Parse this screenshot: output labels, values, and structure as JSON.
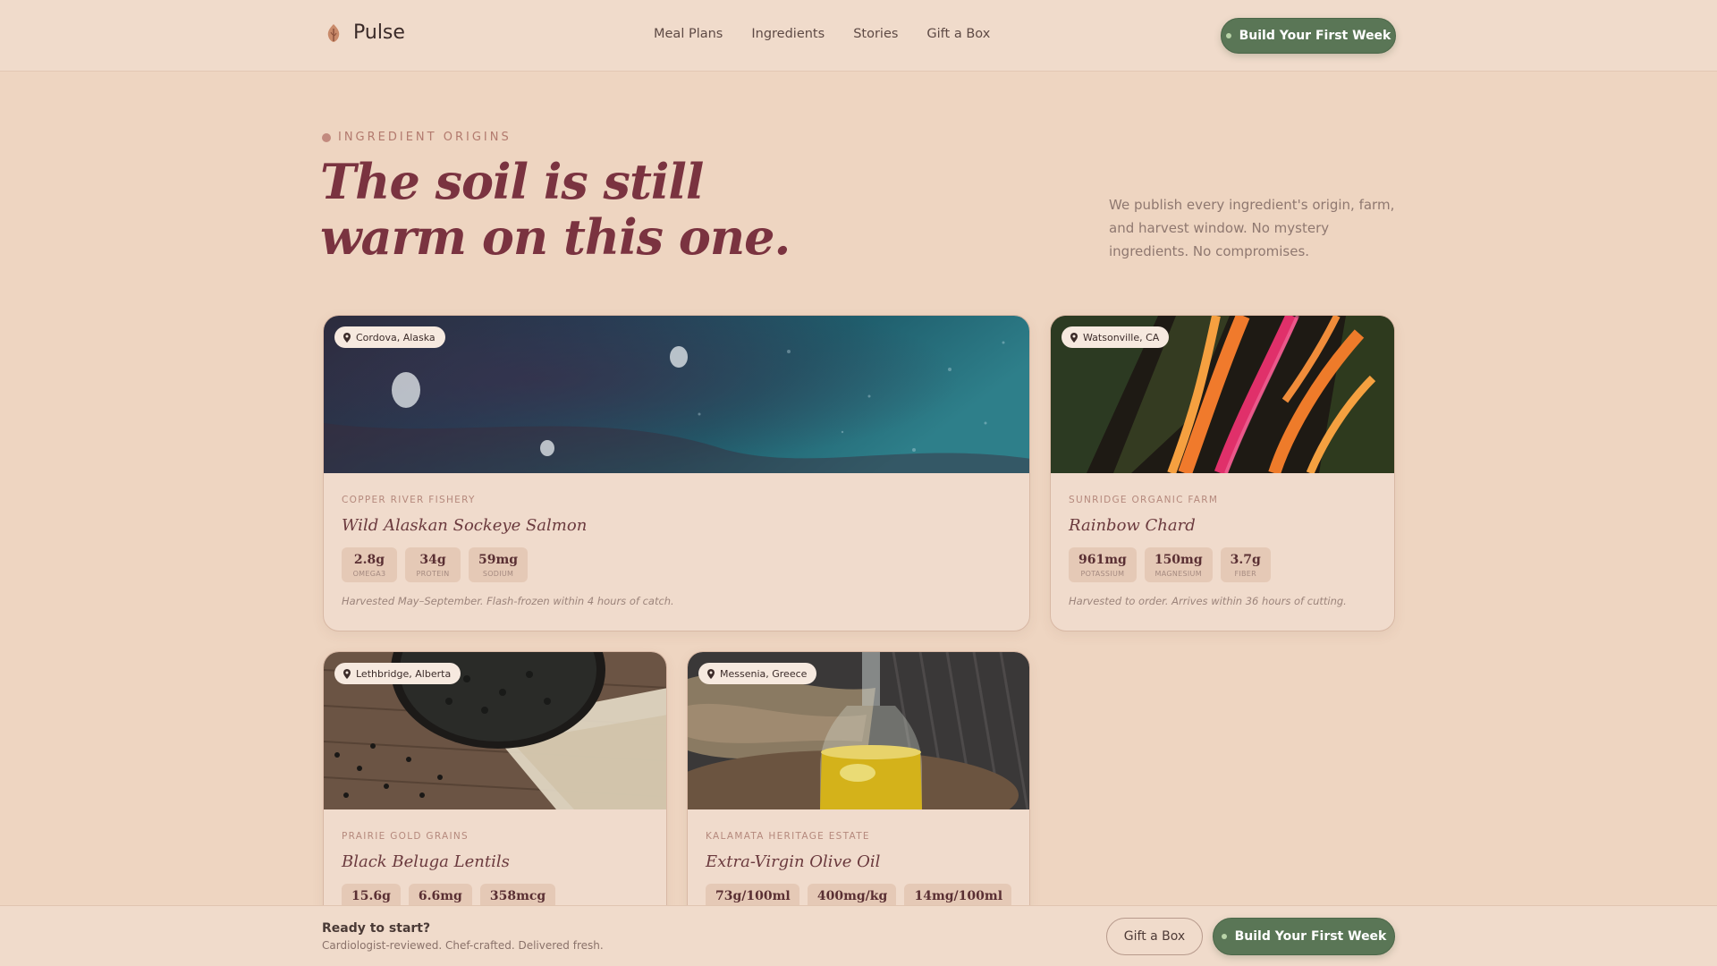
{
  "header": {
    "brand": "Pulse",
    "nav": [
      "Meal Plans",
      "Ingredients",
      "Stories",
      "Gift a Box"
    ],
    "cta": "Build Your First Week"
  },
  "hero": {
    "eyebrow": "INGREDIENT ORIGINS",
    "title_line1": "The soil is still",
    "title_line2": "warm on this one.",
    "description": "We publish every ingredient's origin, farm, and harvest window. No mystery ingredients. No compromises."
  },
  "cards": [
    {
      "location": "Cordova, Alaska",
      "source": "COPPER RIVER FISHERY",
      "name": "Wild Alaskan Sockeye Salmon",
      "stats": [
        {
          "value": "2.8g",
          "label": "OMEGA3"
        },
        {
          "value": "34g",
          "label": "PROTEIN"
        },
        {
          "value": "59mg",
          "label": "SODIUM"
        }
      ],
      "note": "Harvested May–September. Flash-frozen within 4 hours of catch."
    },
    {
      "location": "Watsonville, CA",
      "source": "SUNRIDGE ORGANIC FARM",
      "name": "Rainbow Chard",
      "stats": [
        {
          "value": "961mg",
          "label": "POTASSIUM"
        },
        {
          "value": "150mg",
          "label": "MAGNESIUM"
        },
        {
          "value": "3.7g",
          "label": "FIBER"
        }
      ],
      "note": "Harvested to order. Arrives within 36 hours of cutting."
    },
    {
      "location": "Lethbridge, Alberta",
      "source": "PRAIRIE GOLD GRAINS",
      "name": "Black Beluga Lentils",
      "stats": [
        {
          "value": "15.6g",
          "label": ""
        },
        {
          "value": "6.6mg",
          "label": ""
        },
        {
          "value": "358mcg",
          "label": ""
        }
      ]
    },
    {
      "location": "Messenia, Greece",
      "source": "KALAMATA HERITAGE ESTATE",
      "name": "Extra-Virgin Olive Oil",
      "stats": [
        {
          "value": "73g/100ml",
          "label": ""
        },
        {
          "value": "400mg/kg",
          "label": ""
        },
        {
          "value": "14mg/100ml",
          "label": ""
        }
      ]
    }
  ],
  "bottom_bar": {
    "title": "Ready to start?",
    "subtitle": "Cardiologist-reviewed. Chef-crafted. Delivered fresh.",
    "secondary": "Gift a Box",
    "primary": "Build Your First Week"
  }
}
